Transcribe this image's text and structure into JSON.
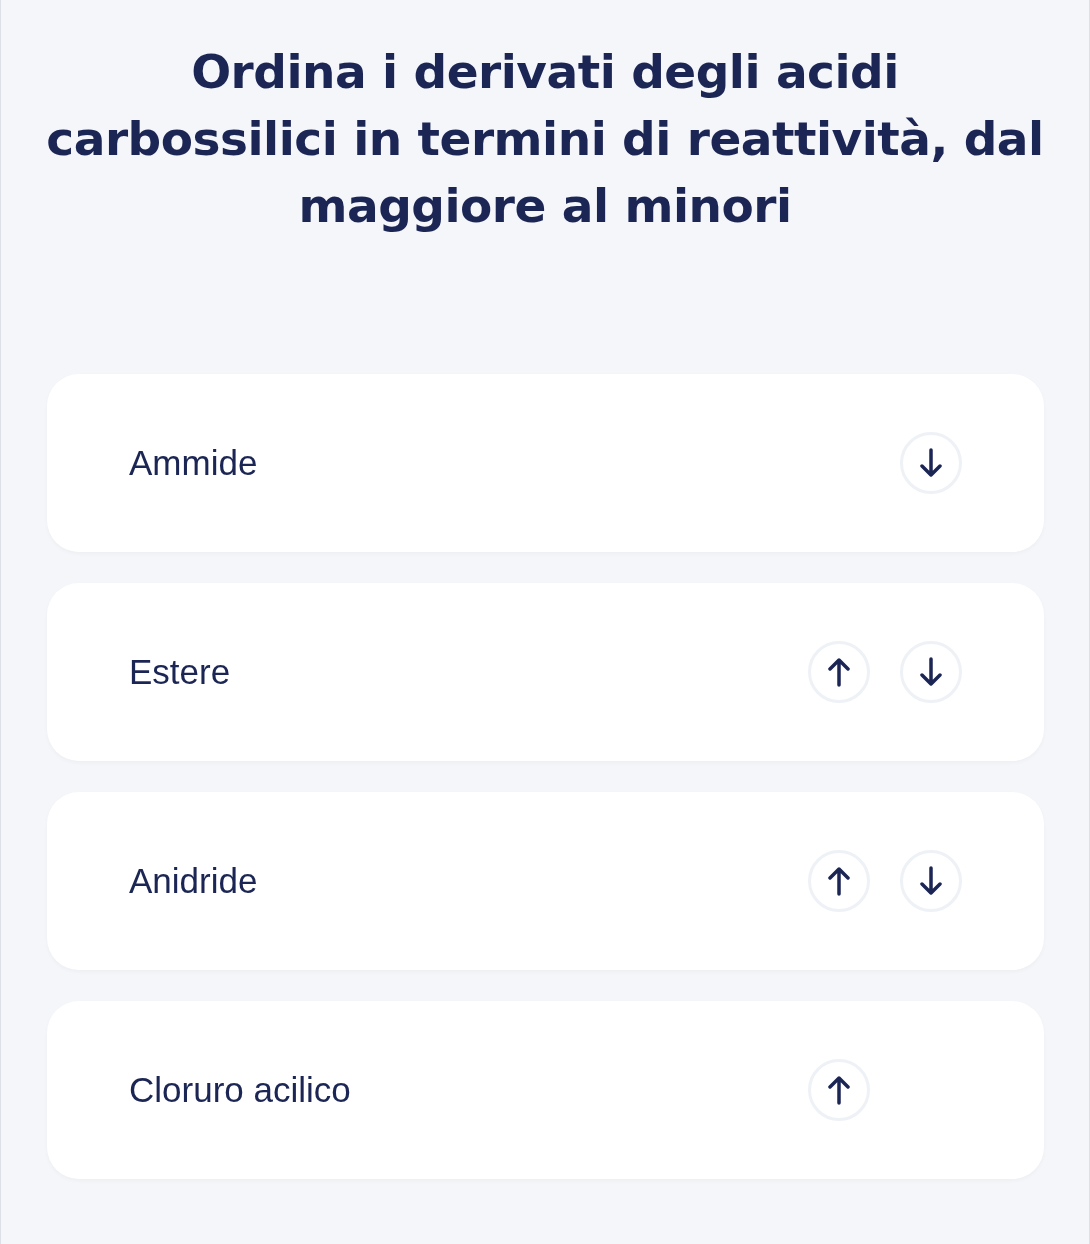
{
  "question": "Ordina i derivati degli acidi carbossilici in termini di reattività, dal maggiore al minori",
  "items": [
    {
      "label": "Ammide",
      "can_move_up": false,
      "can_move_down": true
    },
    {
      "label": "Estere",
      "can_move_up": true,
      "can_move_down": true
    },
    {
      "label": "Anidride",
      "can_move_up": true,
      "can_move_down": true
    },
    {
      "label": "Cloruro acilico",
      "can_move_up": true,
      "can_move_down": false
    }
  ]
}
